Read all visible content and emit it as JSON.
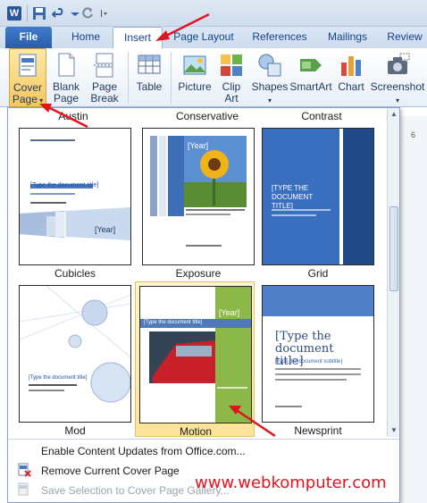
{
  "qat": {
    "app_icon_label": "W"
  },
  "tabs": [
    {
      "label": "File"
    },
    {
      "label": "Home"
    },
    {
      "label": "Insert"
    },
    {
      "label": "Page Layout"
    },
    {
      "label": "References"
    },
    {
      "label": "Mailings"
    },
    {
      "label": "Review"
    }
  ],
  "ribbon": {
    "cover_page": "Cover Page",
    "cover_page_l1": "Cover",
    "cover_page_l2": "Page",
    "blank_l1": "Blank",
    "blank_l2": "Page",
    "break_l1": "Page",
    "break_l2": "Break",
    "table": "Table",
    "picture": "Picture",
    "clip_l1": "Clip",
    "clip_l2": "Art",
    "shapes": "Shapes",
    "smartart": "SmartArt",
    "chart": "Chart",
    "screenshot": "Screenshot"
  },
  "gallery": {
    "top_labels": [
      "Austin",
      "Conservative",
      "Contrast"
    ],
    "covers": [
      {
        "name": "Cubicles",
        "title": "[Type the document title]",
        "year": "[Year]"
      },
      {
        "name": "Exposure",
        "title": "[Type the document title]",
        "year": "[Year]"
      },
      {
        "name": "Grid",
        "title": "[TYPE THE DOCUMENT TITLE]"
      },
      {
        "name": "Mod",
        "title": "[Type the document title]"
      },
      {
        "name": "Motion",
        "title": "[Type the document title]",
        "year": "[Year]"
      },
      {
        "name": "Newsprint",
        "title": "[Type the document title]",
        "subtitle": "[Type the document subtitle]"
      }
    ],
    "menu": [
      {
        "label": "Enable Content Updates from Office.com...",
        "enabled": true
      },
      {
        "label": "Remove Current Cover Page",
        "enabled": true
      },
      {
        "label": "Save Selection to Cover Page Gallery...",
        "enabled": false
      }
    ]
  },
  "ruler": {
    "mark": "6"
  },
  "watermark": "www.webkomputer.com",
  "colors": {
    "accent_red": "#e0141e",
    "selection": "#fde39a",
    "file_tab": "#2a5ea8"
  }
}
